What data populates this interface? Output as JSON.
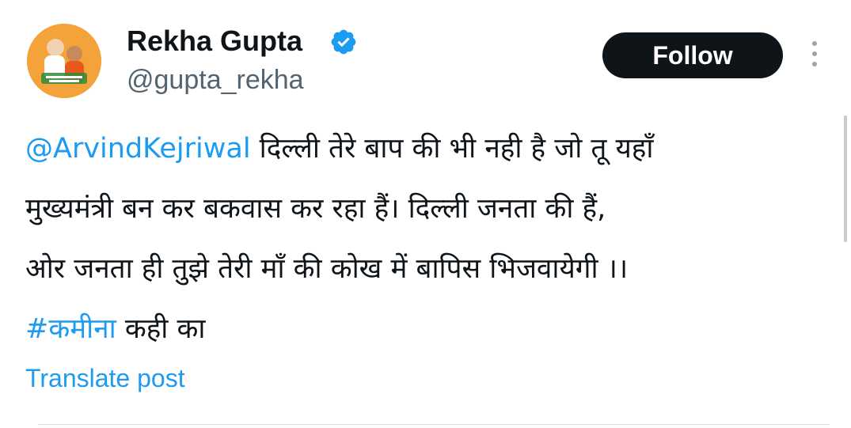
{
  "author": {
    "display_name": "Rekha Gupta",
    "handle": "@gupta_rekha",
    "verified": true,
    "avatar_icon": "profile-avatar"
  },
  "actions": {
    "follow_label": "Follow",
    "more_icon": "more-vertical-icon"
  },
  "tweet": {
    "mention": "@ArvindKejriwal",
    "line1_text": " दिल्ली तेरे बाप की भी नही है जो तू यहाँ",
    "line2_text": "मुख्यमंत्री बन कर बकवास कर रहा हैं। दिल्ली जनता की हैं,",
    "line3_text": "ओर जनता ही तुझे तेरी माँ की कोख में बापिस भिजवायेगी ।।",
    "hashtag": "#कमीना",
    "line4_text": " कही का"
  },
  "translate_label": "Translate post",
  "colors": {
    "link": "#1d9bf0",
    "text": "#0f1419",
    "muted": "#536471",
    "button_bg": "#0f1419",
    "verified": "#1d9bf0"
  }
}
